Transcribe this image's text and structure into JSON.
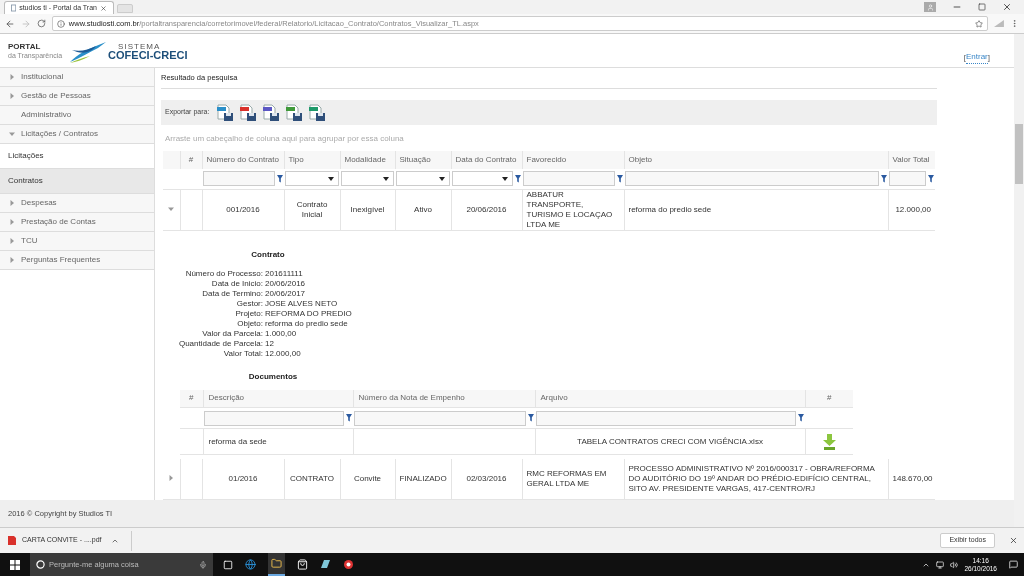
{
  "browser": {
    "tab_title": "studios ti - Portal da Tran",
    "url_host": "www.studiosti.com.br",
    "url_path": "/portaltransparencia/corretorimovel/federal/Relatorio/Licitacao_Contrato/Contratos_Visualizar_TL.aspx"
  },
  "header": {
    "brand_top": "PORTAL",
    "brand_bottom": "da Transparência",
    "logo_caption": "SISTEMA",
    "logo_name": "COFECI-CRECI",
    "login_open": "[",
    "login": "Entrar",
    "login_close": "]"
  },
  "sidebar": {
    "items": [
      {
        "kind": "group",
        "label": "Institucional",
        "expanded": false
      },
      {
        "kind": "group",
        "label": "Gestão de Pessoas",
        "expanded": false
      },
      {
        "kind": "link",
        "label": "Administrativo"
      },
      {
        "kind": "group",
        "label": "Licitações / Contratos",
        "expanded": true
      },
      {
        "kind": "sub",
        "label": "Licitações",
        "selected": false
      },
      {
        "kind": "sub",
        "label": "Contratos",
        "selected": true
      },
      {
        "kind": "group",
        "label": "Despesas",
        "expanded": false
      },
      {
        "kind": "group",
        "label": "Prestação de Contas",
        "expanded": false
      },
      {
        "kind": "group",
        "label": "TCU",
        "expanded": false
      },
      {
        "kind": "group",
        "label": "Perguntas Frequentes",
        "expanded": false
      }
    ]
  },
  "results": {
    "title": "Resultado da pesquisa",
    "export_label": "Exportar para:",
    "export_formats": [
      {
        "color": "#2a8fc9"
      },
      {
        "color": "#d9312b"
      },
      {
        "color": "#5b57c4"
      },
      {
        "color": "#3f9a3a"
      },
      {
        "color": "#1e9a6a"
      }
    ],
    "group_hint": "Arraste um cabeçalho de coluna aqui para agrupar por essa coluna",
    "table": {
      "index_header": "#",
      "columns": [
        {
          "label": "Número do Contrato",
          "kind": "input",
          "filter_button": true
        },
        {
          "label": "Tipo",
          "kind": "select",
          "filter_button": false
        },
        {
          "label": "Modalidade",
          "kind": "select",
          "filter_button": false
        },
        {
          "label": "Situação",
          "kind": "select",
          "filter_button": false
        },
        {
          "label": "Data do Contrato",
          "kind": "select",
          "filter_button": true
        },
        {
          "label": "Favorecido",
          "kind": "input",
          "filter_button": true
        },
        {
          "label": "Objeto",
          "kind": "input",
          "filter_button": true
        },
        {
          "label": "Valor Total",
          "kind": "input",
          "filter_button": true
        }
      ],
      "rows": [
        {
          "expanded": true,
          "cells": [
            "001/2016",
            "Contrato Inicial",
            "Inexigível",
            "Ativo",
            "20/06/2016",
            "ABBATUR TRANSPORTE, TURISMO E LOCAÇAO LTDA ME",
            "reforma do predio sede",
            "12.000,00"
          ],
          "detail": {
            "title": "Contrato",
            "fields": [
              {
                "label": "Número do Processo:",
                "value": "201611111"
              },
              {
                "label": "Data de Inicio:",
                "value": "20/06/2016"
              },
              {
                "label": "Data de Termino:",
                "value": "20/06/2017"
              },
              {
                "label": "Gestor:",
                "value": "JOSE ALVES NETO"
              },
              {
                "label": "Projeto:",
                "value": "REFORMA DO PREDIO"
              },
              {
                "label": "Objeto:",
                "value": "reforma do predio sede"
              },
              {
                "label": "Valor da Parcela:",
                "value": "1.000,00"
              },
              {
                "label": "Quantidade de Parcela:",
                "value": "12"
              },
              {
                "label": "Valor Total:",
                "value": "12.000,00"
              }
            ],
            "documents": {
              "title": "Documentos",
              "index_header": "#",
              "columns": [
                "Descrição",
                "Número da Nota de Empenho",
                "Arquivo"
              ],
              "action_header": "#",
              "rows": [
                {
                  "description": "reforma da sede",
                  "file": "TABELA CONTRATOS CRECI COM VIGÊNCIA.xlsx"
                }
              ]
            }
          }
        },
        {
          "expanded": false,
          "cells": [
            "01/2016",
            "CONTRATO",
            "Convite",
            "FINALIZADO",
            "02/03/2016",
            "RMC REFORMAS EM GERAL LTDA ME",
            "PROCESSO ADMINISTRATIVO Nº 2016/000317 - OBRA/REFORMA DO AUDITÓRIO DO 19º ANDAR DO PRÉDIO-EDIFÍCIO CENTRAL, SITO AV. PRESIDENTE VARGAS, 417-CENTRO/RJ",
            "148.670,00"
          ]
        }
      ]
    }
  },
  "footer": {
    "copyright": "2016 © Copyright by Studios TI"
  },
  "downloads": {
    "file": "CARTA CONVITE - ....pdf",
    "show_all": "Exibir todos"
  },
  "taskbar": {
    "search_placeholder": "Pergunte-me alguma coisa",
    "time": "14:16",
    "date": "26/10/2016"
  }
}
